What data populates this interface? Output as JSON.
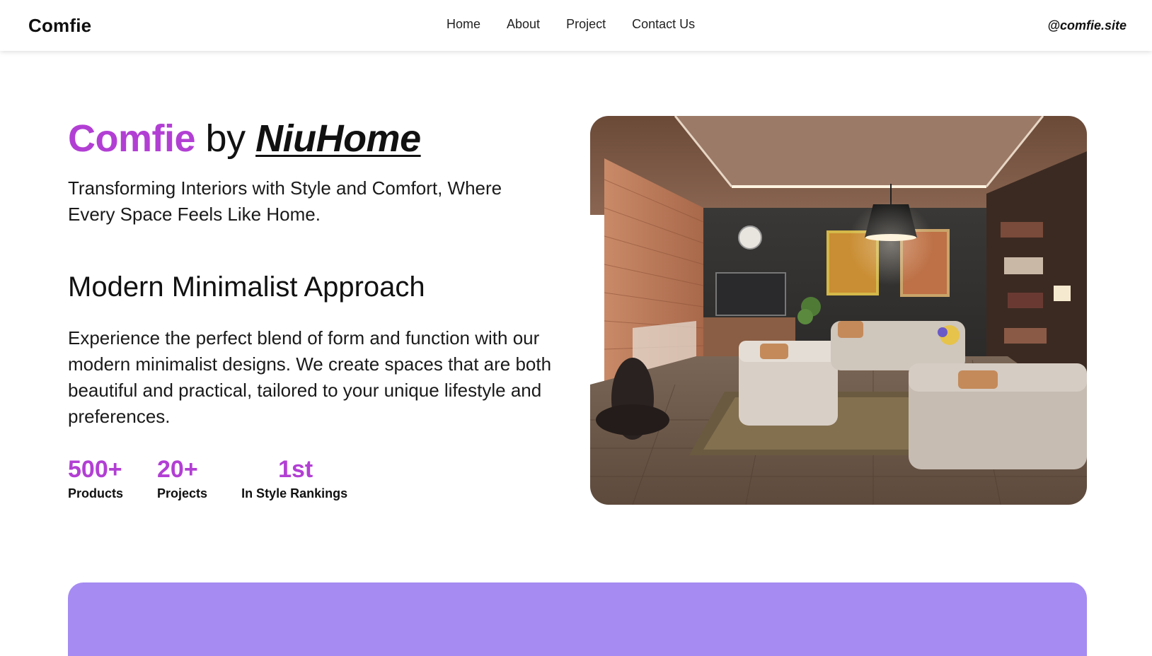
{
  "nav": {
    "brand": "Comfie",
    "links": [
      "Home",
      "About",
      "Project",
      "Contact Us"
    ],
    "handle": "@comfie.site"
  },
  "hero": {
    "title_accent": "Comfie",
    "title_by": "by",
    "title_brand": "NiuHome",
    "subtitle": "Transforming Interiors with Style and Comfort, Where Every Space Feels Like Home."
  },
  "section": {
    "heading": "Modern Minimalist Approach",
    "body": "Experience the perfect blend of form and function with our modern minimalist designs. We create spaces that are both beautiful and practical, tailored to your unique lifestyle and preferences."
  },
  "stats": [
    {
      "value": "500+",
      "label": "Products"
    },
    {
      "value": "20+",
      "label": "Projects"
    },
    {
      "value": "1st",
      "label": "In Style Rankings"
    }
  ],
  "colors": {
    "accent": "#b23fd4",
    "band": "#a58bf2"
  }
}
